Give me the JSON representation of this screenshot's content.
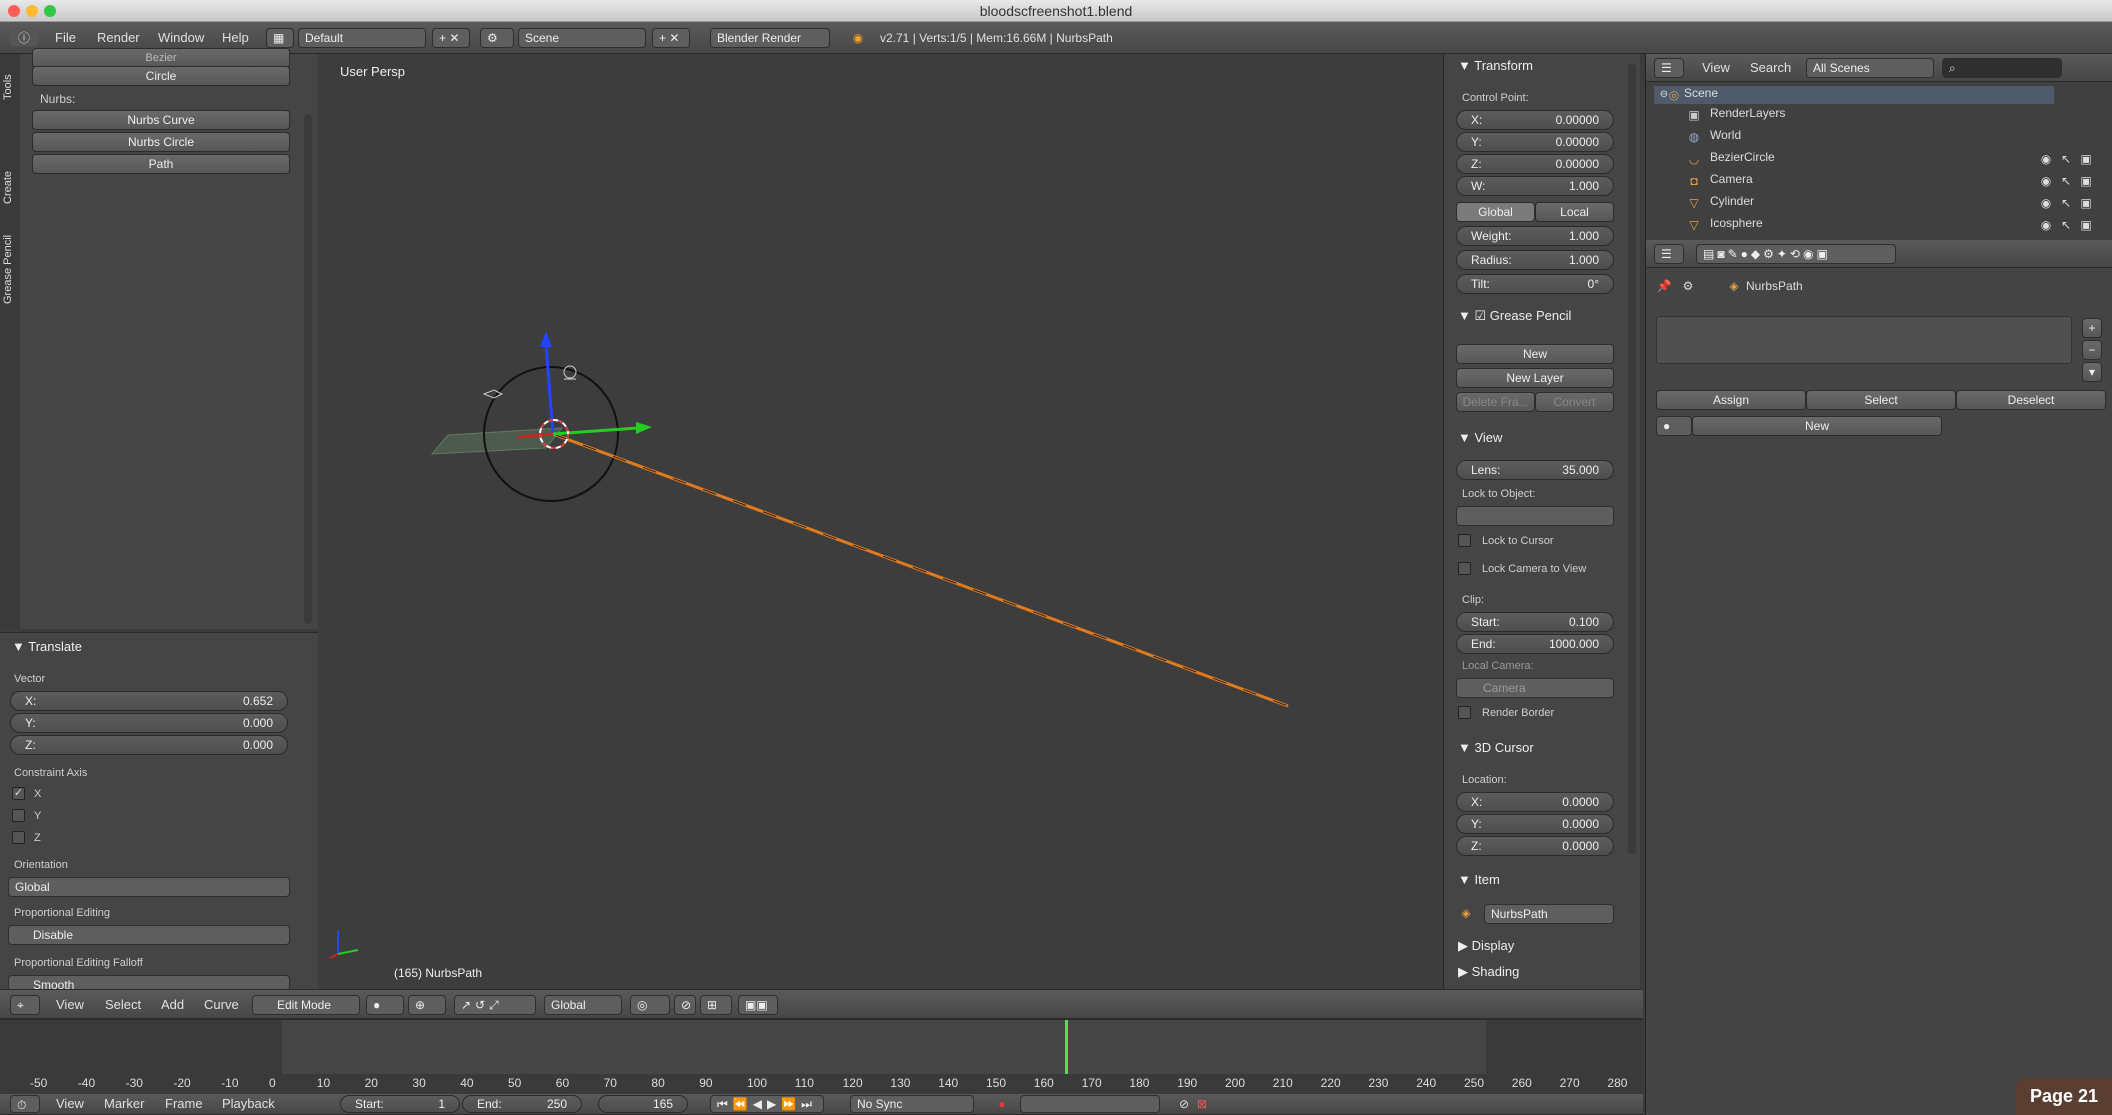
{
  "window": {
    "title": "bloodscfreenshot1.blend"
  },
  "info_header": {
    "menus": [
      "File",
      "Render",
      "Window",
      "Help"
    ],
    "layout": "Default",
    "scene": "Scene",
    "engine": "Blender Render",
    "stats": "v2.71 | Verts:1/5 | Mem:16.66M | NurbsPath"
  },
  "toolshelf": {
    "tabs": [
      "Tools",
      "Create",
      "Grease Pencil"
    ],
    "partial_label": "Bezier",
    "circle_label": "Circle",
    "nurbs_header": "Nurbs:",
    "nurbs_items": [
      "Nurbs Curve",
      "Nurbs Circle",
      "Path"
    ]
  },
  "operator": {
    "title": "Translate",
    "vector_label": "Vector",
    "x": {
      "label": "X:",
      "value": "0.652"
    },
    "y": {
      "label": "Y:",
      "value": "0.000"
    },
    "z": {
      "label": "Z:",
      "value": "0.000"
    },
    "constraint_label": "Constraint Axis",
    "constraint": [
      {
        "label": "X",
        "checked": true
      },
      {
        "label": "Y",
        "checked": false
      },
      {
        "label": "Z",
        "checked": false
      }
    ],
    "orientation_label": "Orientation",
    "orientation_value": "Global",
    "prop_edit_label": "Proportional Editing",
    "prop_edit_value": "Disable",
    "falloff_label": "Proportional Editing Falloff",
    "falloff_value": "Smooth"
  },
  "viewport": {
    "view_name": "User Persp",
    "object_info": "(165) NurbsPath",
    "colors": {
      "path": "#e07a1f",
      "x_axis": "#cc2222",
      "y_axis": "#22cc22",
      "z_axis": "#2244ff"
    }
  },
  "properties_n": {
    "transform_title": "Transform",
    "control_point_label": "Control Point:",
    "cp": [
      {
        "label": "X:",
        "value": "0.00000"
      },
      {
        "label": "Y:",
        "value": "0.00000"
      },
      {
        "label": "Z:",
        "value": "0.00000"
      },
      {
        "label": "W:",
        "value": "1.000"
      }
    ],
    "global_label": "Global",
    "local_label": "Local",
    "weight": {
      "label": "Weight:",
      "value": "1.000"
    },
    "radius": {
      "label": "Radius:",
      "value": "1.000"
    },
    "tilt": {
      "label": "Tilt:",
      "value": "0°"
    },
    "grease_title": "Grease Pencil",
    "new_label": "New",
    "new_layer_label": "New Layer",
    "delete_frame_label": "Delete Fra...",
    "convert_label": "Convert",
    "view_title": "View",
    "lens": {
      "label": "Lens:",
      "value": "35.000"
    },
    "lock_object_label": "Lock to Object:",
    "lock_cursor_label": "Lock to Cursor",
    "lock_camera_label": "Lock Camera to View",
    "clip_label": "Clip:",
    "clip_start": {
      "label": "Start:",
      "value": "0.100"
    },
    "clip_end": {
      "label": "End:",
      "value": "1000.000"
    },
    "local_camera_label": "Local Camera:",
    "camera_value": "Camera",
    "render_border_label": "Render Border",
    "cursor_title": "3D Cursor",
    "location_label": "Location:",
    "loc": [
      {
        "label": "X:",
        "value": "0.0000"
      },
      {
        "label": "Y:",
        "value": "0.0000"
      },
      {
        "label": "Z:",
        "value": "0.0000"
      }
    ],
    "item_title": "Item",
    "item_name": "NurbsPath",
    "display_title": "Display",
    "shading_title": "Shading"
  },
  "outliner": {
    "menus": [
      "View",
      "Search"
    ],
    "filter": "All Scenes",
    "items": [
      "Scene",
      "RenderLayers",
      "World",
      "BezierCircle",
      "Camera",
      "Cylinder",
      "Icosphere"
    ]
  },
  "props_editor": {
    "breadcrumb": "NurbsPath",
    "assign_label": "Assign",
    "select_label": "Select",
    "deselect_label": "Deselect",
    "new_label": "New"
  },
  "view3d_header": {
    "menus": [
      "View",
      "Select",
      "Add",
      "Curve"
    ],
    "mode": "Edit Mode",
    "orientation": "Global"
  },
  "timeline": {
    "ticks": [
      "-50",
      "-40",
      "-30",
      "-20",
      "-10",
      "0",
      "10",
      "20",
      "30",
      "40",
      "50",
      "60",
      "70",
      "80",
      "90",
      "100",
      "110",
      "120",
      "130",
      "140",
      "150",
      "160",
      "170",
      "180",
      "190",
      "200",
      "210",
      "220",
      "230",
      "240",
      "250",
      "260",
      "270",
      "280"
    ],
    "current_frame_value": 165,
    "menus": [
      "View",
      "Marker",
      "Frame",
      "Playback"
    ],
    "start": {
      "label": "Start:",
      "value": "1"
    },
    "end": {
      "label": "End:",
      "value": "250"
    },
    "current": "165",
    "sync": "No Sync"
  },
  "page_badge": "Page 21"
}
